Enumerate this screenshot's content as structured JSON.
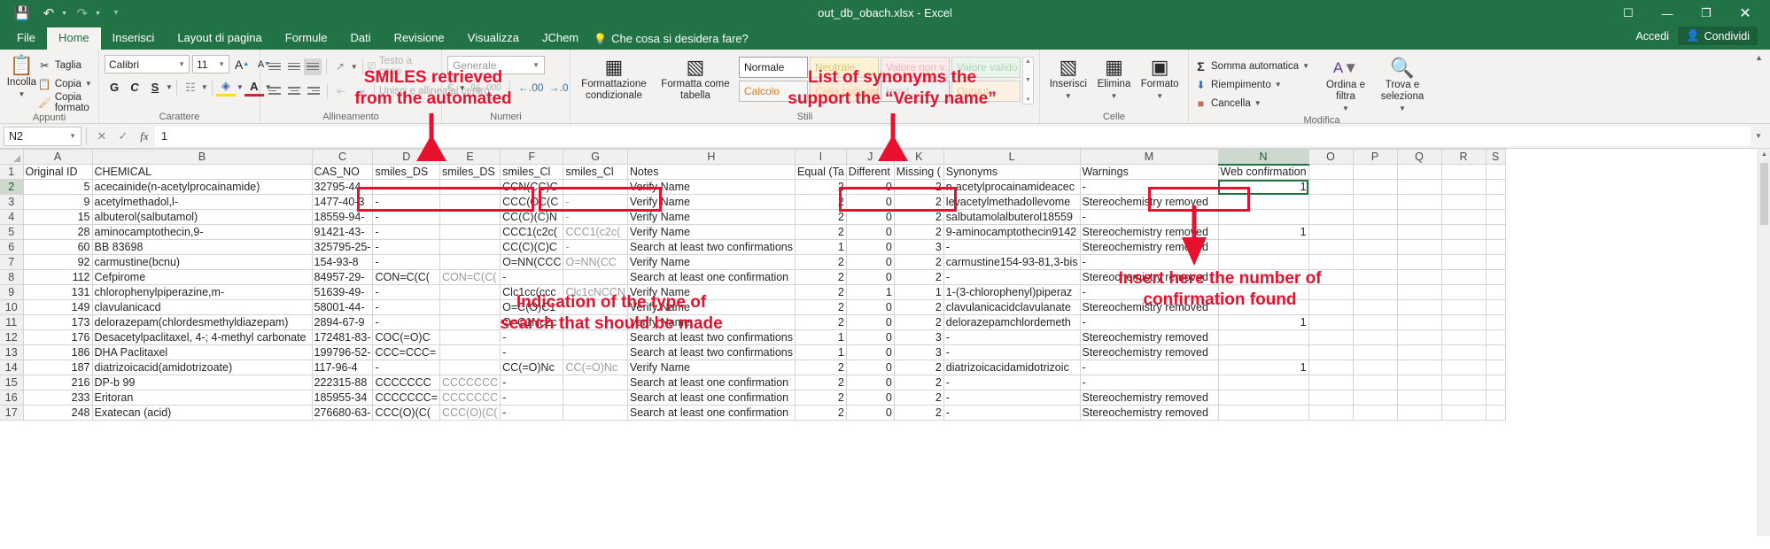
{
  "window": {
    "title": "out_db_obach.xlsx - Excel",
    "quick_access": [
      "save-icon",
      "undo-icon",
      "redo-icon",
      "customize-qat-icon"
    ],
    "controls": {
      "ribbon_display": "ribbon-display-options-icon",
      "minimize": "—",
      "restore": "❐",
      "close": "✕"
    },
    "account": "Accedi",
    "share": "Condividi"
  },
  "ribbon": {
    "tabs": [
      {
        "label": "File",
        "active": false
      },
      {
        "label": "Home",
        "active": true
      },
      {
        "label": "Inserisci",
        "active": false
      },
      {
        "label": "Layout di pagina",
        "active": false
      },
      {
        "label": "Formule",
        "active": false
      },
      {
        "label": "Dati",
        "active": false
      },
      {
        "label": "Revisione",
        "active": false
      },
      {
        "label": "Visualizza",
        "active": false
      },
      {
        "label": "JChem",
        "active": false
      }
    ],
    "tell_me": "Che cosa si desidera fare?",
    "groups": {
      "clipboard": {
        "label": "Appunti",
        "paste": "Incolla",
        "cut": "Taglia",
        "copy": "Copia",
        "format_painter": "Copia formato"
      },
      "font": {
        "label": "Carattere",
        "font_name": "Calibri",
        "font_size": "11",
        "grow": "A",
        "shrink": "A",
        "bold": "G",
        "italic": "C",
        "underline": "S"
      },
      "alignment": {
        "label": "Allineamento",
        "wrap_text": "Testo a capo",
        "merge": "Unisci e allinea al centro"
      },
      "number": {
        "label": "Numeri",
        "format": "Generale",
        "percent": "%",
        "thousands": "000"
      },
      "styles": {
        "label": "Stili",
        "conditional_formatting": "Formattazione condizionale",
        "format_as_table": "Formatta come tabella",
        "gallery": [
          "Normale",
          "Neutrale",
          "Valore non v...",
          "Valore valido",
          "Calcolo",
          "Cella collegata",
          "Input",
          "Output"
        ]
      },
      "cells": {
        "label": "Celle",
        "insert": "Inserisci",
        "delete": "Elimina",
        "format": "Formato"
      },
      "editing": {
        "label": "Modifica",
        "autosum": "Somma automatica",
        "fill": "Riempimento",
        "clear": "Cancella",
        "sort_filter": "Ordina e filtra",
        "find_select": "Trova e seleziona"
      }
    }
  },
  "formula_bar": {
    "name_box": "N2",
    "cancel": "✕",
    "confirm": "✓",
    "insert_function": "fx",
    "value": "1"
  },
  "sheet": {
    "columns": [
      "A",
      "B",
      "C",
      "D",
      "E",
      "F",
      "G",
      "H",
      "I",
      "J",
      "K",
      "L",
      "M",
      "N",
      "O",
      "P",
      "Q",
      "R",
      "S"
    ],
    "selected_column": "N",
    "selected_row": 2,
    "row_numbers": [
      1,
      2,
      3,
      4,
      5,
      6,
      7,
      8,
      9,
      10,
      11,
      12,
      13,
      14,
      15,
      16,
      17
    ],
    "headers": {
      "A": "Original ID",
      "B": "CHEMICAL",
      "C": "CAS_NO",
      "D": "smiles_DS",
      "E": "smiles_DS",
      "F": "smiles_Cl",
      "G": "smiles_Cl",
      "H": "Notes",
      "I": "Equal (Ta",
      "J": "Different",
      "K": "Missing (",
      "L": "Synonyms",
      "M": "Warnings",
      "N": "Web confirmation",
      "O": "",
      "P": "",
      "Q": "",
      "R": "",
      "S": ""
    },
    "rows": [
      {
        "n": 2,
        "A": "5",
        "B": "acecainide(n-acetylprocainamide)",
        "C": "32795-44-",
        "D": "-",
        "E": "",
        "F": "CCN(CC)C",
        "G": "-",
        "H": "Verify Name",
        "I": "2",
        "J": "0",
        "K": "2",
        "L": "n-acetylprocainamideacec",
        "M": "-",
        "N": "1"
      },
      {
        "n": 3,
        "A": "9",
        "B": "acetylmethadol,l-",
        "C": "1477-40-3",
        "D": "-",
        "E": "",
        "F": "CCC(OC(C",
        "G": "-",
        "H": "Verify Name",
        "I": "2",
        "J": "0",
        "K": "2",
        "L": "levacetylmethadollevome",
        "M": "Stereochemistry removed",
        "N": ""
      },
      {
        "n": 4,
        "A": "15",
        "B": "albuterol(salbutamol)",
        "C": "18559-94-",
        "D": "-",
        "E": "",
        "F": "CC(C)(C)N",
        "G": "-",
        "H": "Verify Name",
        "I": "2",
        "J": "0",
        "K": "2",
        "L": "salbutamolalbuterol18559",
        "M": "-",
        "N": ""
      },
      {
        "n": 5,
        "A": "28",
        "B": "aminocamptothecin,9-",
        "C": "91421-43-",
        "D": "-",
        "E": "",
        "F": "CCC1(c2c(",
        "G": "CCC1(c2c(",
        "H": "Verify Name",
        "I": "2",
        "J": "0",
        "K": "2",
        "L": "9-aminocamptothecin9142",
        "M": "Stereochemistry removed",
        "N": "1"
      },
      {
        "n": 6,
        "A": "60",
        "B": "BB 83698",
        "C": "325795-25-",
        "D": "-",
        "E": "",
        "F": "CC(C)(C)C",
        "G": "-",
        "H": "Search at least two confirmations",
        "I": "1",
        "J": "0",
        "K": "3",
        "L": "-",
        "M": "Stereochemistry removed",
        "N": ""
      },
      {
        "n": 7,
        "A": "92",
        "B": "carmustine(bcnu)",
        "C": "154-93-8",
        "D": "-",
        "E": "",
        "F": "O=NN(CCC",
        "G": "O=NN(CC",
        "H": "Verify Name",
        "I": "2",
        "J": "0",
        "K": "2",
        "L": "carmustine154-93-81,3-bis",
        "M": "-",
        "N": ""
      },
      {
        "n": 8,
        "A": "112",
        "B": "Cefpirome",
        "C": "84957-29-",
        "D": "CON=C(C(",
        "E": "CON=C(C(",
        "F": "-",
        "G": "",
        "H": "Search at least one confirmation",
        "I": "2",
        "J": "0",
        "K": "2",
        "L": "-",
        "M": "Stereochemistry removed",
        "N": ""
      },
      {
        "n": 9,
        "A": "131",
        "B": "chlorophenylpiperazine,m-",
        "C": "51639-49-",
        "D": "-",
        "E": "",
        "F": "Clc1cc(ccc",
        "G": "Clc1cNCCN",
        "H": "Verify Name",
        "I": "2",
        "J": "1",
        "K": "1",
        "L": "1-(3-chlorophenyl)piperaz",
        "M": "-",
        "N": ""
      },
      {
        "n": 10,
        "A": "149",
        "B": "clavulanicacd",
        "C": "58001-44-",
        "D": "-",
        "E": "",
        "F": "O=C(O)C1",
        "G": "",
        "H": "Verify Name",
        "I": "2",
        "J": "0",
        "K": "2",
        "L": "clavulanicacidclavulanate",
        "M": "Stereochemistry removed",
        "N": ""
      },
      {
        "n": 11,
        "A": "173",
        "B": "delorazepam(chlordesmethyldiazepam)",
        "C": "2894-67-9",
        "D": "-",
        "E": "",
        "F": "O=C1Nc2c",
        "G": "",
        "H": "Verify Name",
        "I": "2",
        "J": "0",
        "K": "2",
        "L": "delorazepamchlordemeth",
        "M": "-",
        "N": "1"
      },
      {
        "n": 12,
        "A": "176",
        "B": "Desacetylpaclitaxel, 4-; 4-methyl carbonate",
        "C": "172481-83-",
        "D": "COC(=O)C",
        "E": "",
        "F": "-",
        "G": "",
        "H": "Search at least two confirmations",
        "I": "1",
        "J": "0",
        "K": "3",
        "L": "-",
        "M": "Stereochemistry removed",
        "N": ""
      },
      {
        "n": 13,
        "A": "186",
        "B": "DHA Paclitaxel",
        "C": "199796-52-",
        "D": "CCC=CCC=",
        "E": "",
        "F": "-",
        "G": "",
        "H": "Search at least two confirmations",
        "I": "1",
        "J": "0",
        "K": "3",
        "L": "-",
        "M": "Stereochemistry removed",
        "N": ""
      },
      {
        "n": 14,
        "A": "187",
        "B": "diatrizoicacid(amidotrizoate)",
        "C": "117-96-4",
        "D": "-",
        "E": "",
        "F": "CC(=O)Nc",
        "G": "CC(=O)Nc",
        "H": "Verify Name",
        "I": "2",
        "J": "0",
        "K": "2",
        "L": "diatrizoicacidamidotrizoic",
        "M": "-",
        "N": "1"
      },
      {
        "n": 15,
        "A": "216",
        "B": "DP-b 99",
        "C": "222315-88",
        "D": "CCCCCCC",
        "E": "CCCCCCC",
        "F": "-",
        "G": "",
        "H": "Search at least one confirmation",
        "I": "2",
        "J": "0",
        "K": "2",
        "L": "-",
        "M": "-",
        "N": ""
      },
      {
        "n": 16,
        "A": "233",
        "B": "Eritoran",
        "C": "185955-34",
        "D": "CCCCCCC=",
        "E": "CCCCCCC",
        "F": "-",
        "G": "",
        "H": "Search at least one confirmation",
        "I": "2",
        "J": "0",
        "K": "2",
        "L": "-",
        "M": "Stereochemistry removed",
        "N": ""
      },
      {
        "n": 17,
        "A": "248",
        "B": "Exatecan (acid)",
        "C": "276680-63-",
        "D": "CCC(O)(C(",
        "E": "CCC(O)(C(",
        "F": "-",
        "G": "",
        "H": "Search at least one confirmation",
        "I": "2",
        "J": "0",
        "K": "2",
        "L": "-",
        "M": "Stereochemistry removed",
        "N": ""
      }
    ]
  },
  "annotations": [
    {
      "id": "smiles-note",
      "text": "SMILES retrieved\nfrom the automated"
    },
    {
      "id": "synonyms-note",
      "text": "List of synonyms the\nsupport the “Verify name”"
    },
    {
      "id": "search-type-note",
      "text": "Indication of the type of\nsearch that should be made"
    },
    {
      "id": "insert-number-note",
      "text": "Insert here the number of\nconfirmation found"
    }
  ],
  "colors": {
    "excel_green": "#217346",
    "annotation_red": "#e8112d",
    "ribbon_bg": "#f3f2f1"
  }
}
